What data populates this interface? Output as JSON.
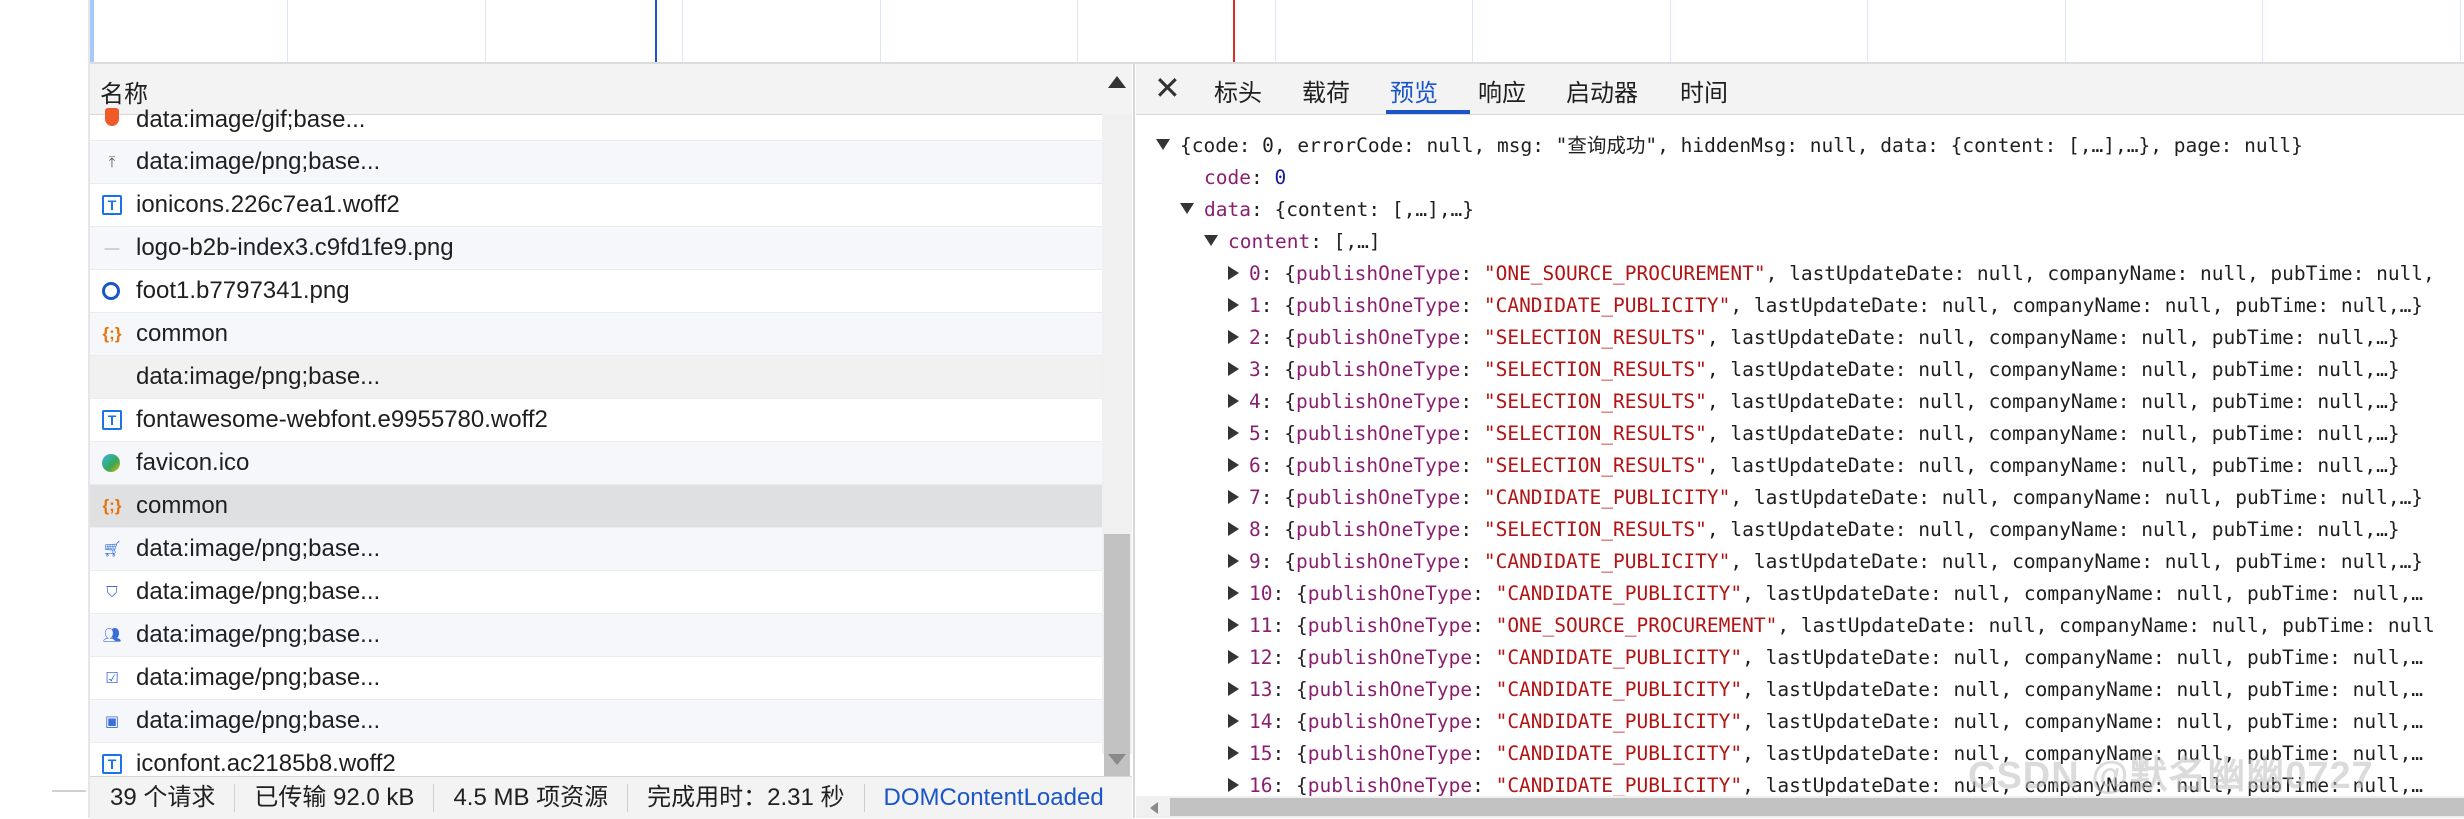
{
  "list": {
    "header": "名称",
    "rows": [
      {
        "name": "data:image/gif;base...",
        "icon": "orange-shield-icon"
      },
      {
        "name": "data:image/png;base...",
        "icon": "upload-arrow-icon"
      },
      {
        "name": "ionicons.226c7ea1.woff2",
        "icon": "font-file-icon"
      },
      {
        "name": "logo-b2b-index3.c9fd1fe9.png",
        "icon": "line-image-icon"
      },
      {
        "name": "foot1.b7797341.png",
        "icon": "c-circle-icon"
      },
      {
        "name": "common",
        "icon": "script-braces-icon"
      },
      {
        "name": "data:image/png;base...",
        "icon": "blank-icon"
      },
      {
        "name": "fontawesome-webfont.e9955780.woff2",
        "icon": "font-file-icon"
      },
      {
        "name": "favicon.ico",
        "icon": "favicon-icon"
      },
      {
        "name": "common",
        "icon": "script-braces-icon"
      },
      {
        "name": "data:image/png;base...",
        "icon": "cart-icon"
      },
      {
        "name": "data:image/png;base...",
        "icon": "shield-check-icon"
      },
      {
        "name": "data:image/png;base...",
        "icon": "users-icon"
      },
      {
        "name": "data:image/png;base...",
        "icon": "checkbox-icon"
      },
      {
        "name": "data:image/png;base...",
        "icon": "briefcase-icon"
      },
      {
        "name": "iconfont.ac2185b8.woff2",
        "icon": "font-file-icon"
      }
    ]
  },
  "status": {
    "requests": "39 个请求",
    "transferred": "已传输 92.0 kB",
    "resources": "4.5 MB 项资源",
    "finish": "完成用时：2.31 秒",
    "dcl": "DOMContentLoaded"
  },
  "tabs": {
    "close": "✕",
    "headers": "标头",
    "payload": "载荷",
    "preview": "预览",
    "response": "响应",
    "initiator": "启动器",
    "timing": "时间"
  },
  "json": {
    "root": "{code: 0, errorCode: null, msg: \"查询成功\", hiddenMsg: null, data: {content: [,…],…}, page: null}",
    "code_key": "code",
    "code_value": "0",
    "data_key": "data",
    "data_value": "{content: [,…],…}",
    "content_key": "content",
    "content_value": "[,…]",
    "items": [
      {
        "idx": "0",
        "type": "\"ONE_SOURCE_PROCUREMENT\"",
        "tail": ", lastUpdateDate: null, companyName: null, pubTime: null,"
      },
      {
        "idx": "1",
        "type": "\"CANDIDATE_PUBLICITY\"",
        "tail": ", lastUpdateDate: null, companyName: null, pubTime: null,…}"
      },
      {
        "idx": "2",
        "type": "\"SELECTION_RESULTS\"",
        "tail": ", lastUpdateDate: null, companyName: null, pubTime: null,…}"
      },
      {
        "idx": "3",
        "type": "\"SELECTION_RESULTS\"",
        "tail": ", lastUpdateDate: null, companyName: null, pubTime: null,…}"
      },
      {
        "idx": "4",
        "type": "\"SELECTION_RESULTS\"",
        "tail": ", lastUpdateDate: null, companyName: null, pubTime: null,…}"
      },
      {
        "idx": "5",
        "type": "\"SELECTION_RESULTS\"",
        "tail": ", lastUpdateDate: null, companyName: null, pubTime: null,…}"
      },
      {
        "idx": "6",
        "type": "\"SELECTION_RESULTS\"",
        "tail": ", lastUpdateDate: null, companyName: null, pubTime: null,…}"
      },
      {
        "idx": "7",
        "type": "\"CANDIDATE_PUBLICITY\"",
        "tail": ", lastUpdateDate: null, companyName: null, pubTime: null,…}"
      },
      {
        "idx": "8",
        "type": "\"SELECTION_RESULTS\"",
        "tail": ", lastUpdateDate: null, companyName: null, pubTime: null,…}"
      },
      {
        "idx": "9",
        "type": "\"CANDIDATE_PUBLICITY\"",
        "tail": ", lastUpdateDate: null, companyName: null, pubTime: null,…}"
      },
      {
        "idx": "10",
        "type": "\"CANDIDATE_PUBLICITY\"",
        "tail": ", lastUpdateDate: null, companyName: null, pubTime: null,…"
      },
      {
        "idx": "11",
        "type": "\"ONE_SOURCE_PROCUREMENT\"",
        "tail": ", lastUpdateDate: null, companyName: null, pubTime: null"
      },
      {
        "idx": "12",
        "type": "\"CANDIDATE_PUBLICITY\"",
        "tail": ", lastUpdateDate: null, companyName: null, pubTime: null,…"
      },
      {
        "idx": "13",
        "type": "\"CANDIDATE_PUBLICITY\"",
        "tail": ", lastUpdateDate: null, companyName: null, pubTime: null,…"
      },
      {
        "idx": "14",
        "type": "\"CANDIDATE_PUBLICITY\"",
        "tail": ", lastUpdateDate: null, companyName: null, pubTime: null,…"
      },
      {
        "idx": "15",
        "type": "\"CANDIDATE_PUBLICITY\"",
        "tail": ", lastUpdateDate: null, companyName: null, pubTime: null,…"
      },
      {
        "idx": "16",
        "type": "\"CANDIDATE_PUBLICITY\"",
        "tail": ", lastUpdateDate: null, companyName: null, pubTime: null,…"
      }
    ]
  },
  "watermark": "CSDN @默名幽幽0727",
  "colors": {
    "accent": "#1a56c8",
    "json_key": "#8b1f6f",
    "json_string": "#b11414",
    "json_number": "#1a1aa6",
    "timeline_red": "#d93025",
    "selected_row": "#dfe0e1"
  }
}
